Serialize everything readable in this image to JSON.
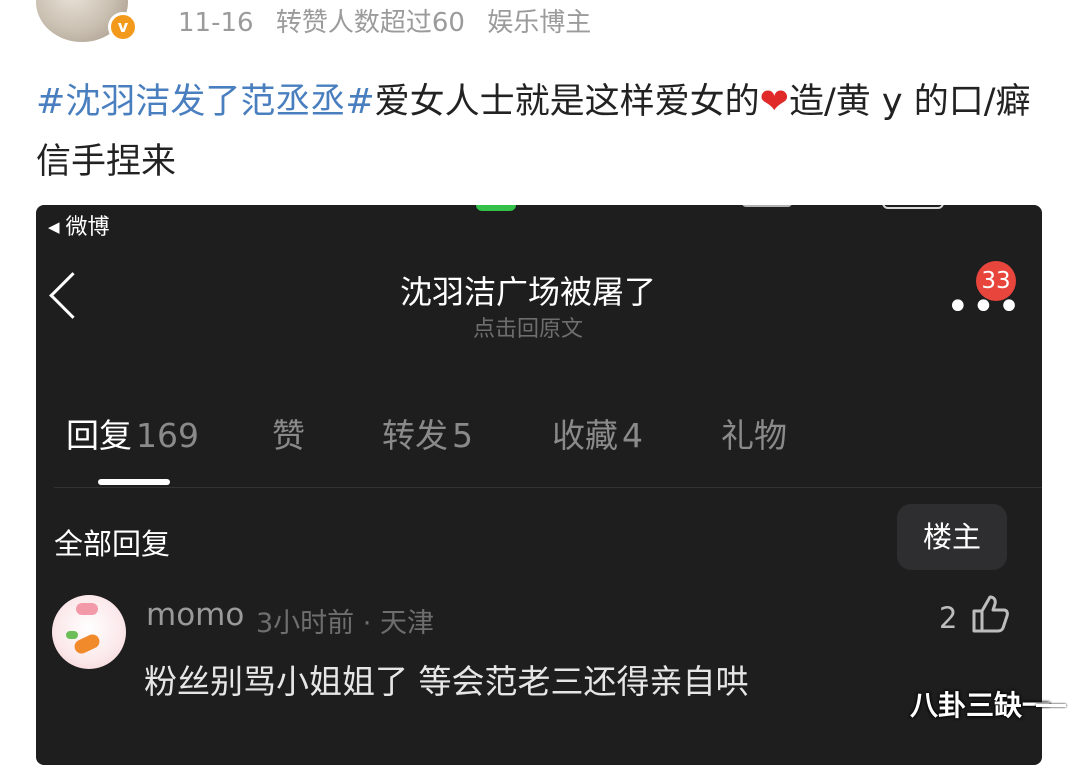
{
  "post": {
    "date": "11-16",
    "repost_note": "转赞人数超过60",
    "author_tag": "娱乐博主",
    "verified_badge": "v",
    "hashtag": "#沈羽洁发了范丞丞#",
    "text_part1": "爱女人士就是这样爱女的",
    "heart": "❤",
    "text_part2": "造/黄 y 的口/癖信手捏来"
  },
  "screenshot": {
    "status_back_label": "微博",
    "status_back_arrow": "◀",
    "title": "沈羽洁广场被屠了",
    "subtitle": "点击回原文",
    "more_icon": "•••",
    "notification_count": "33",
    "tabs": [
      {
        "label": "回复",
        "count": "169"
      },
      {
        "label": "赞",
        "count": ""
      },
      {
        "label": "转发",
        "count": "5"
      },
      {
        "label": "收藏",
        "count": "4"
      },
      {
        "label": "礼物",
        "count": ""
      }
    ],
    "section_title": "全部回复",
    "owner_filter": "楼主",
    "comment": {
      "user": "momo",
      "time": "3小时前",
      "location": "天津",
      "separator": "·",
      "likes": "2",
      "text": "粉丝别骂小姐姐了 等会范老三还得亲自哄"
    }
  },
  "watermark": "八卦三缺一",
  "colors": {
    "hashtag": "#4a7fbf",
    "verified": "#f39a1d",
    "badge_red": "#e8453c",
    "dark_bg": "#1e1e1f"
  }
}
